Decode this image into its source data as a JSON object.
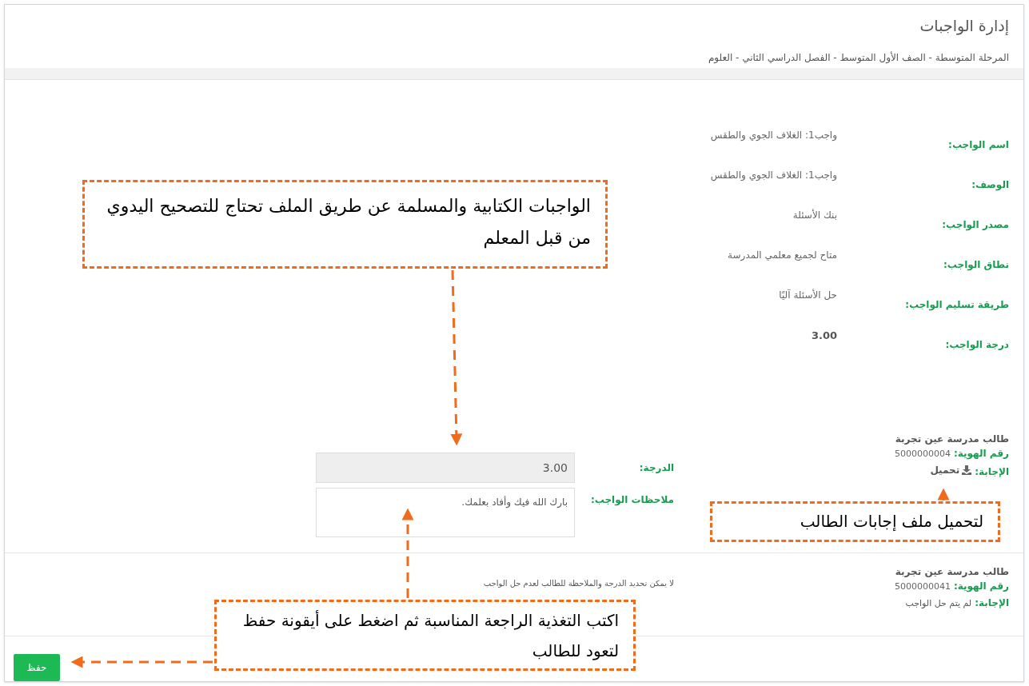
{
  "header": {
    "title": "إدارة الواجبات",
    "subtitle": "المرحلة المتوسطة - الصف الأول المتوسط - الفصل الدراسي الثاني - العلوم"
  },
  "details": [
    {
      "label": "اسم الواجب:",
      "value": "واجب1: الغلاف الجوي والطقس",
      "kind": "text"
    },
    {
      "label": "الوصف:",
      "value": "واجب1: الغلاف الجوي والطقس",
      "kind": "text"
    },
    {
      "label": "مصدر الواجب:",
      "value": "بنك الأسئلة",
      "kind": "text"
    },
    {
      "label": "نطاق الواجب:",
      "value": "متاح لجميع معلمي المدرسة",
      "kind": "text"
    },
    {
      "label": "طريقة تسليم الواجب:",
      "value": "حل الأسئلة آليًا",
      "kind": "text"
    },
    {
      "label": "درجة الواجب:",
      "value": "3.00",
      "kind": "grade"
    }
  ],
  "students": [
    {
      "name": "طالب مدرسة عين تجربة",
      "id_label": "رقم الهوية:",
      "id": "5000000004",
      "answer_label": "الإجابة:",
      "answer": {
        "kind": "download",
        "text": "تحميل"
      },
      "form": {
        "kind": "grading",
        "grade_label": "الدرجة:",
        "grade_value": "3.00",
        "notes_label": "ملاحظات الواجب:",
        "notes_value": "بارك الله فيك وأفاد بعلمك."
      }
    },
    {
      "name": "طالب مدرسة عين تجربة",
      "id_label": "رقم الهوية:",
      "id": "5000000041",
      "answer_label": "الإجابة:",
      "answer": {
        "kind": "none",
        "text": "لم يتم حل الواجب"
      },
      "form": {
        "kind": "message",
        "text": "لا يمكن تحديد الدرجة والملاحظة للطالب لعدم حل الواجب"
      }
    }
  ],
  "save_button": "حفظ",
  "annotations": [
    {
      "text": "الواجبات الكتابية والمسلمة عن طريق الملف تحتاج للتصحيح اليدوي من قبل المعلم"
    },
    {
      "text": "لتحميل ملف إجابات الطالب"
    },
    {
      "text": "اكتب التغذية الراجعة المناسبة ثم اضغط على أيقونة حفظ لتعود للطالب"
    }
  ]
}
